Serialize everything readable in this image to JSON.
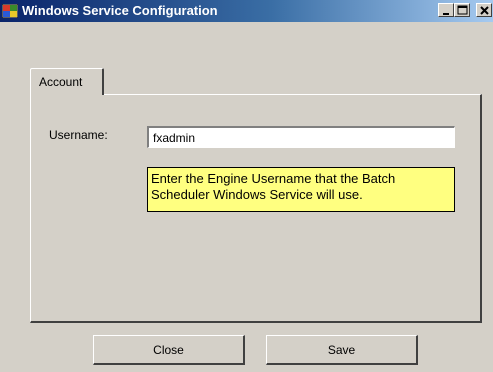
{
  "window": {
    "title": "Windows Service Configuration"
  },
  "titlebar_icons": [
    "app-icon",
    "minimize-icon",
    "maximize-icon",
    "close-icon"
  ],
  "tabs": [
    {
      "label": "Account"
    }
  ],
  "form": {
    "username_label": "Username:",
    "username_value": "fxadmin",
    "hint": "Enter the Engine Username that the Batch Scheduler Windows Service will use."
  },
  "buttons": {
    "close_label": "Close",
    "save_label": "Save"
  },
  "colors": {
    "titlebar_start": "#0a246a",
    "titlebar_end": "#a6caf0",
    "hint_background": "#ffff80",
    "window_background": "#d4d0c8"
  }
}
